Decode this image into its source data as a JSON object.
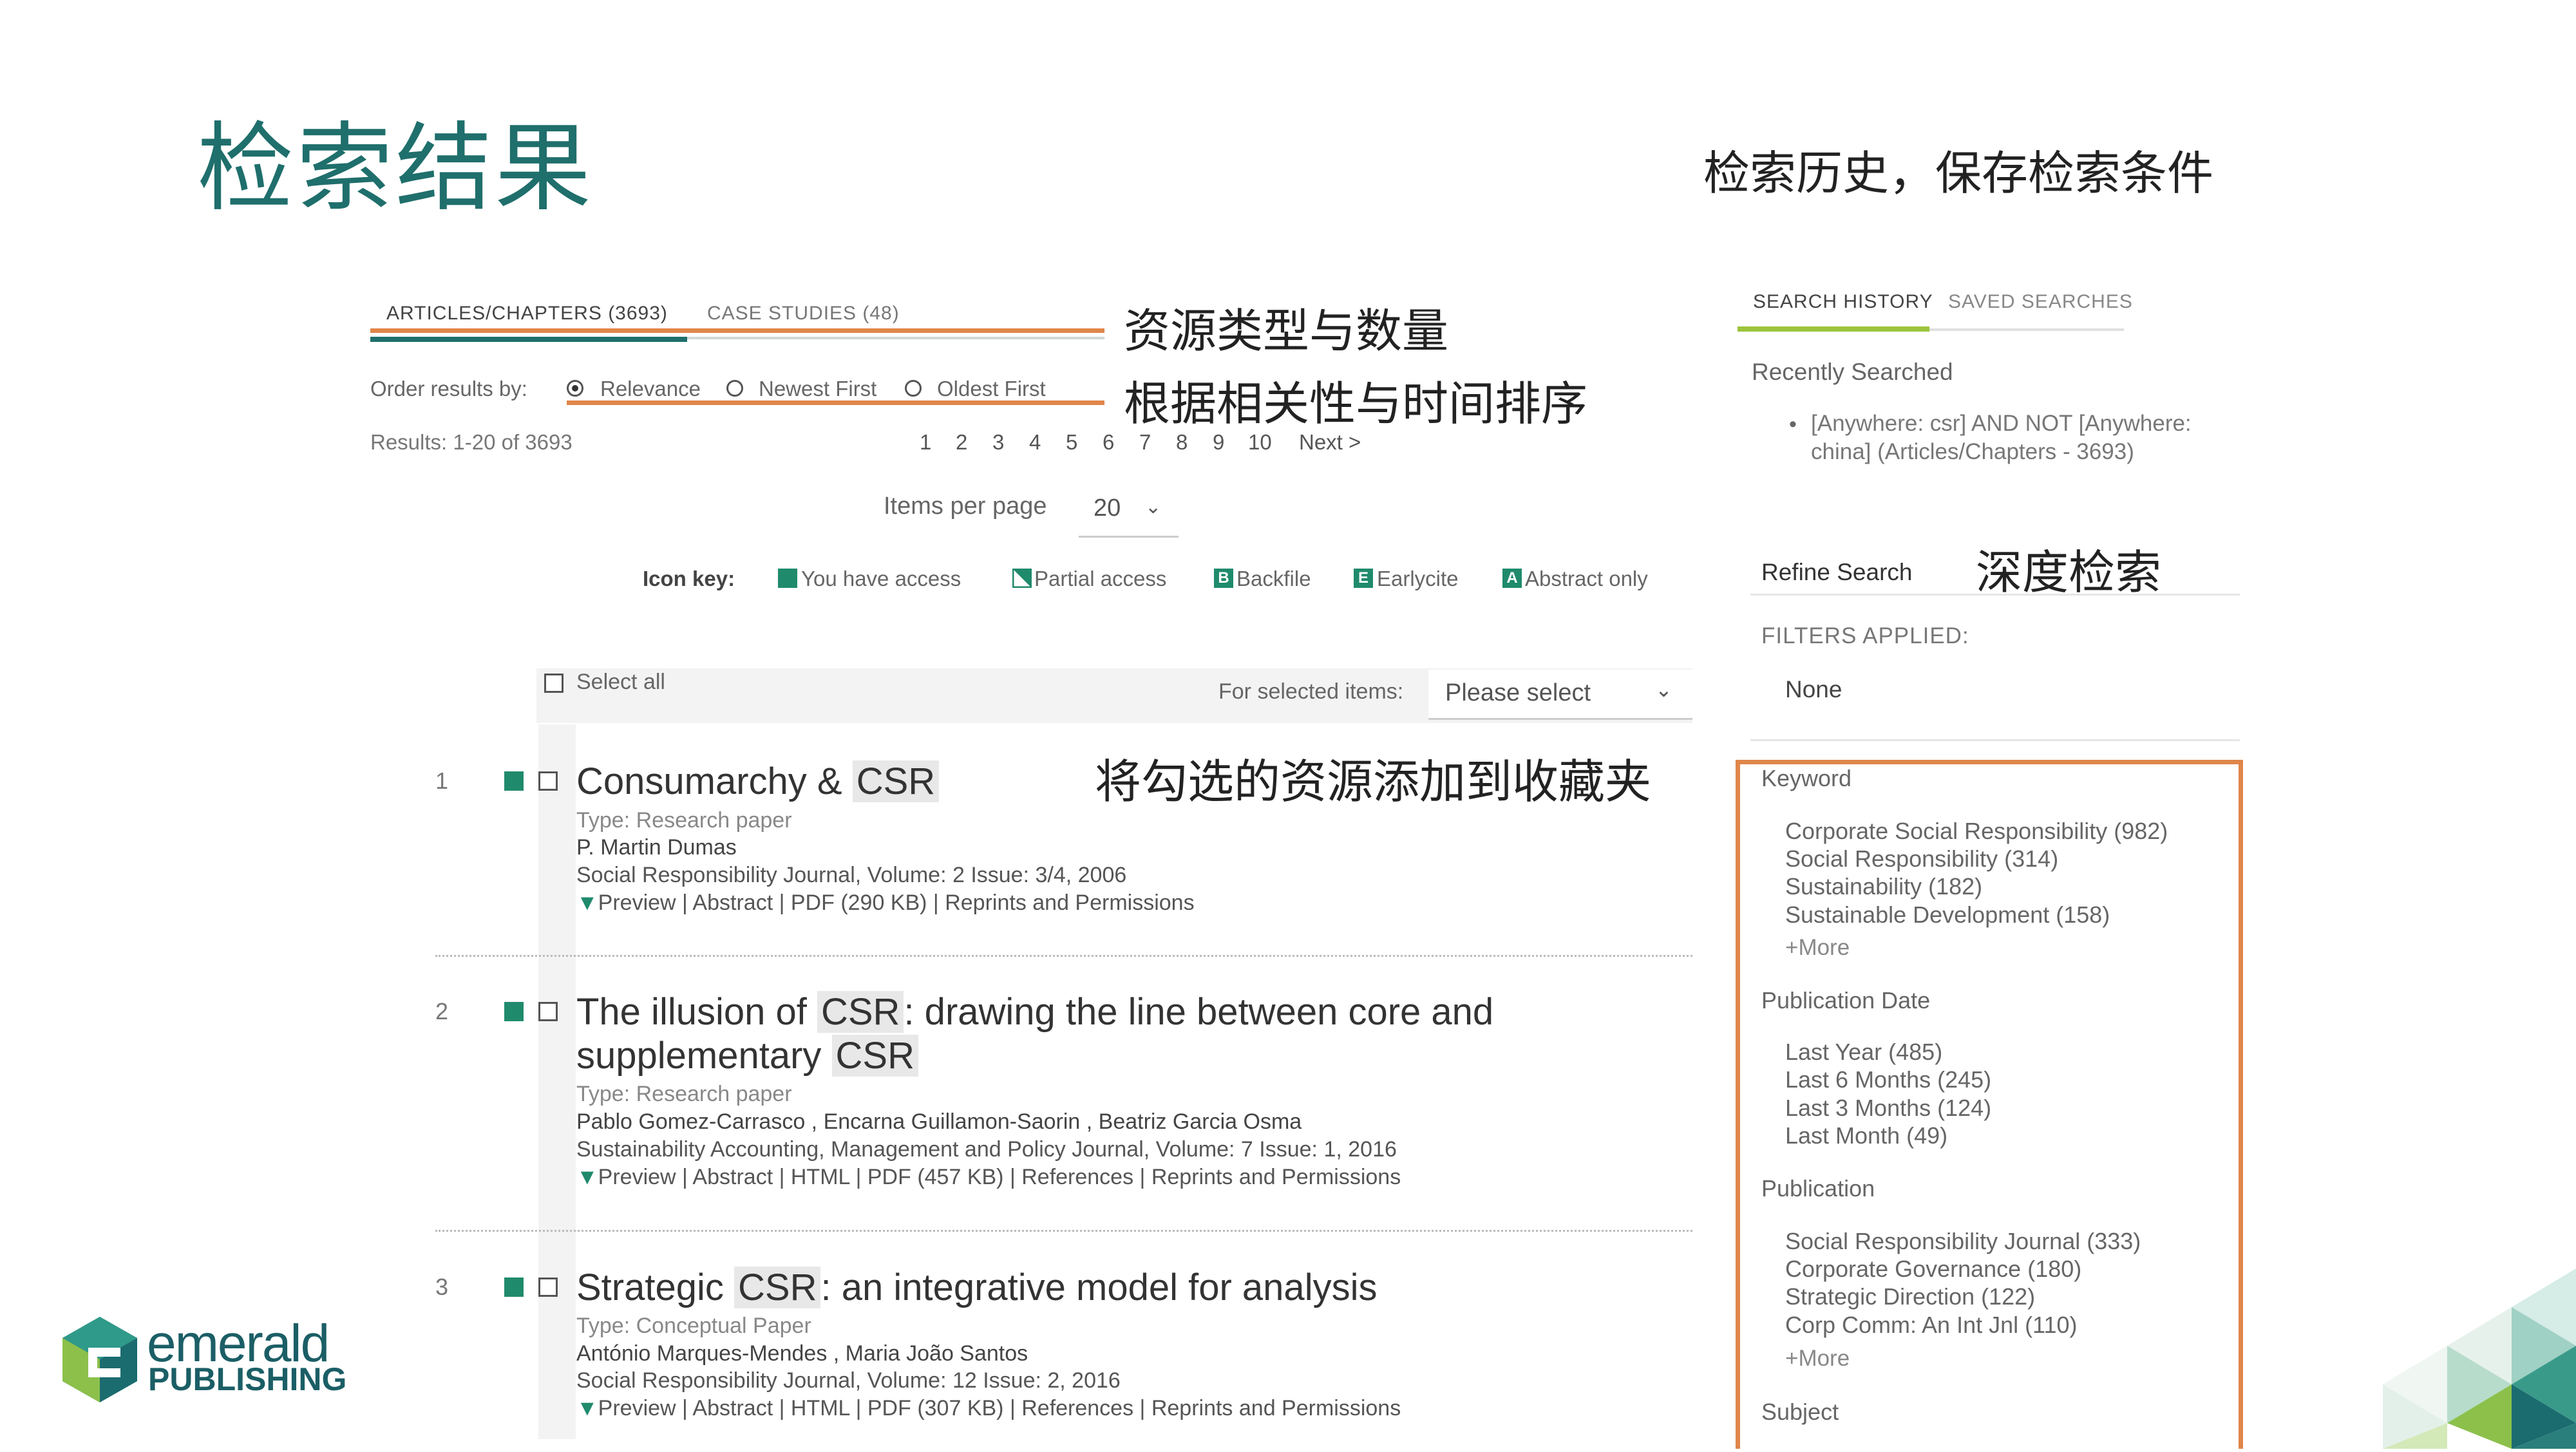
{
  "slide": {
    "title": "检索结果",
    "notes": {
      "history": "检索历史，保存检索条件",
      "types": "资源类型与数量",
      "sort": "根据相关性与时间排序",
      "refine": "深度检索",
      "favorites": "将勾选的资源添加到收藏夹"
    }
  },
  "tabs": {
    "articles": "ARTICLES/CHAPTERS (3693)",
    "cases": "CASE STUDIES (48)"
  },
  "order": {
    "label": "Order results by:",
    "options": [
      "Relevance",
      "Newest First",
      "Oldest First"
    ],
    "selected": "Relevance"
  },
  "results_count": "Results: 1-20 of 3693",
  "pagination": [
    "1",
    "2",
    "3",
    "4",
    "5",
    "6",
    "7",
    "8",
    "9",
    "10",
    "Next >"
  ],
  "items_per_page": {
    "label": "Items per page",
    "value": "20"
  },
  "icon_key": {
    "label": "Icon key:",
    "items": [
      {
        "glyph": "",
        "label": "You have access"
      },
      {
        "glyph": "",
        "label": "Partial access"
      },
      {
        "glyph": "B",
        "label": "Backfile"
      },
      {
        "glyph": "E",
        "label": "Earlycite"
      },
      {
        "glyph": "A",
        "label": "Abstract only"
      }
    ]
  },
  "select_bar": {
    "select_all": "Select all",
    "for_selected": "For selected items:",
    "placeholder": "Please select"
  },
  "results": [
    {
      "num": "1",
      "title_parts": [
        "Consumarchy & ",
        "CSR"
      ],
      "type": "Type: Research paper",
      "authors": "P. Martin Dumas",
      "journal": "Social Responsibility Journal, Volume: 2 Issue: 3/4, 2006",
      "links": "Preview | Abstract | PDF (290 KB) | Reprints and Permissions"
    },
    {
      "num": "2",
      "title_parts": [
        "The illusion of ",
        "CSR",
        ": drawing the line between core and"
      ],
      "title_line2": [
        "supplementary ",
        "CSR"
      ],
      "type": "Type: Research paper",
      "authors": "Pablo Gomez-Carrasco , Encarna Guillamon-Saorin , Beatriz Garcia Osma",
      "journal": "Sustainability Accounting, Management and Policy Journal, Volume: 7 Issue: 1, 2016",
      "links": "Preview | Abstract | HTML | PDF (457 KB) | References | Reprints and Permissions"
    },
    {
      "num": "3",
      "title_parts": [
        "Strategic ",
        "CSR",
        ": an integrative model for analysis"
      ],
      "type": "Type: Conceptual Paper",
      "authors": "António Marques-Mendes , Maria João Santos",
      "journal": "Social Responsibility Journal, Volume: 12 Issue: 2, 2016",
      "links": "Preview | Abstract | HTML | PDF (307 KB) | References | Reprints and Permissions"
    }
  ],
  "right_panel": {
    "tab_history": "SEARCH HISTORY",
    "tab_saved": "SAVED SEARCHES",
    "recently_searched": "Recently Searched",
    "recent_query_l1": "[Anywhere: csr] AND NOT [Anywhere:",
    "recent_query_l2": "china] (Articles/Chapters - 3693)",
    "refine": "Refine Search",
    "filters_applied": "FILTERS APPLIED:",
    "filters_none": "None",
    "facets": {
      "keyword": {
        "heading": "Keyword",
        "items": [
          "Corporate Social Responsibility (982)",
          "Social Responsibility (314)",
          "Sustainability (182)",
          "Sustainable Development (158)"
        ],
        "more": "+More"
      },
      "date": {
        "heading": "Publication Date",
        "items": [
          "Last Year (485)",
          "Last 6 Months (245)",
          "Last 3 Months (124)",
          "Last Month (49)"
        ]
      },
      "publication": {
        "heading": "Publication",
        "items": [
          "Social Responsibility Journal (333)",
          "Corporate Governance (180)",
          "Strategic Direction (122)",
          "Corp Comm: An Int Jnl (110)"
        ],
        "more": "+More"
      },
      "subject": {
        "heading": "Subject"
      }
    }
  },
  "logo": {
    "line1": "emerald",
    "line2": "PUBLISHING"
  },
  "colors": {
    "accent_teal": "#1f6f6c",
    "access_green": "#1f8a6c",
    "annotation_orange": "#e0864a",
    "tab_lime": "#9bc43b"
  }
}
